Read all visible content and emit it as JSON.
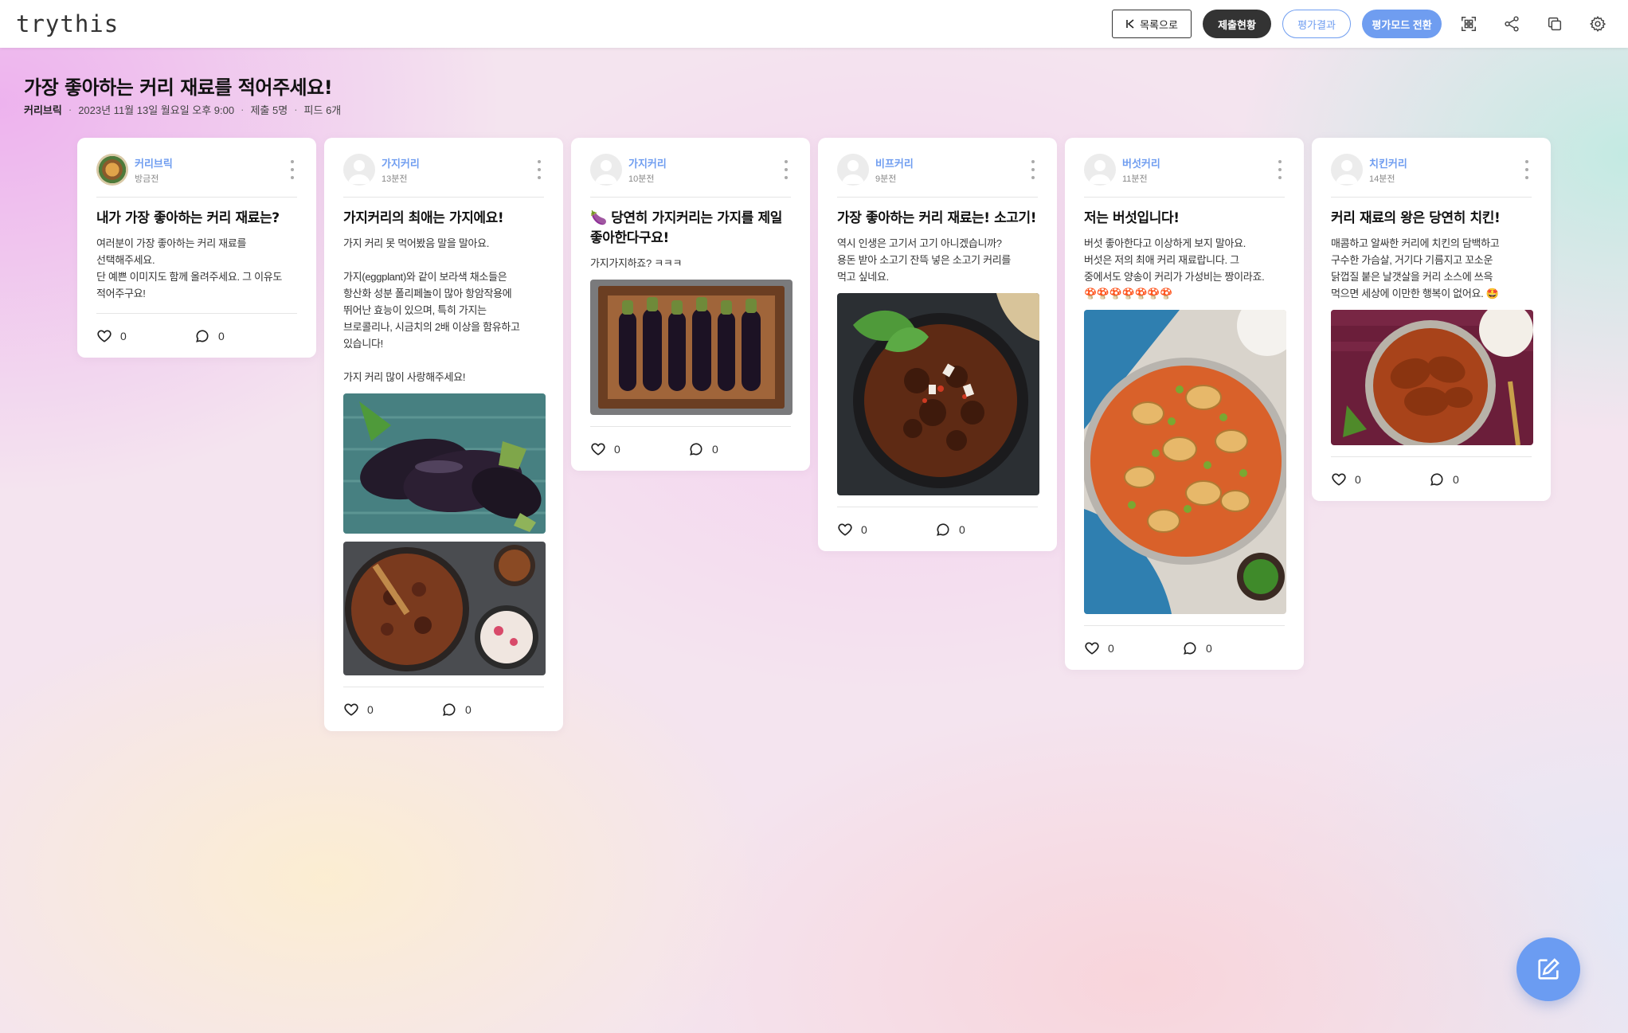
{
  "app": {
    "logo": "trythis"
  },
  "header": {
    "list_button": "목록으로",
    "submission_button": "제출현황",
    "result_button": "평가결과",
    "mode_button": "평가모드 전환",
    "icons": [
      "qr-scan-icon",
      "share-icon",
      "copy-icon",
      "settings-icon"
    ]
  },
  "page": {
    "title": "가장 좋아하는 커리 재료를 적어주세요!",
    "author": "커리브릭",
    "date": "2023년 11월 13일 월요일 오후 9:00",
    "submissions": "제출 5명",
    "feeds": "피드 6개"
  },
  "cards": [
    {
      "author": "커리브릭",
      "time": "방금전",
      "title": "내가 가장 좋아하는 커리 재료는?",
      "body": "여러분이 가장 좋아하는 커리 재료를\n선택해주세요.\n단 예쁜 이미지도 함께 올려주세요. 그 이유도\n적어주구요!",
      "likes": "0",
      "comments": "0"
    },
    {
      "author": "가지커리",
      "time": "13분전",
      "title": "가지커리의 최애는 가지에요!",
      "body": "가지 커리 못 먹어봤음 말을 말아요.\n\n가지(eggplant)와 같이 보라색 채소들은\n항산화 성분 폴리페놀이 많아 항암작용에\n뛰어난 효능이 있으며, 특히 가지는\n브로콜리나, 시금치의 2배 이상을 함유하고\n있습니다!\n\n가지 커리 많이 사랑해주세요!",
      "likes": "0",
      "comments": "0"
    },
    {
      "author": "가지커리",
      "time": "10분전",
      "title": "🍆 당연히 가지커리는 가지를 제일 좋아한다구요!",
      "body": "가지가지하죠? ㅋㅋㅋ",
      "likes": "0",
      "comments": "0"
    },
    {
      "author": "비프커리",
      "time": "9분전",
      "title": "가장 좋아하는 커리 재료는! 소고기!",
      "body": "역시 인생은 고기서 고기 아니겠습니까?\n용돈 받아 소고기 잔뜩 넣은 소고기 커리를\n먹고 싶네요.",
      "likes": "0",
      "comments": "0"
    },
    {
      "author": "버섯커리",
      "time": "11분전",
      "title": "저는 버섯입니다!",
      "body": "버섯 좋아한다고 이상하게 보지 말아요.\n버섯은 저의 최애 커리 재료랍니다. 그\n중에서도 양송이 커리가 가성비는 짱이라죠.\n🍄🍄🍄🍄🍄🍄🍄",
      "likes": "0",
      "comments": "0"
    },
    {
      "author": "치킨커리",
      "time": "14분전",
      "title": "커리 재료의 왕은 당연히 치킨!",
      "body": "매콤하고 알싸한 커리에 치킨의 담백하고\n구수한 가슴살, 거기다 기름지고 꼬소운\n닭껍질 붙은 날갯살을 커리 소스에 쓰윽\n먹으면 세상에 이만한 행복이 없어요. 🤩",
      "likes": "0",
      "comments": "0"
    }
  ],
  "colors": {
    "accent": "#6f9df0",
    "dark": "#333333",
    "fab": "#6b9cf2"
  }
}
